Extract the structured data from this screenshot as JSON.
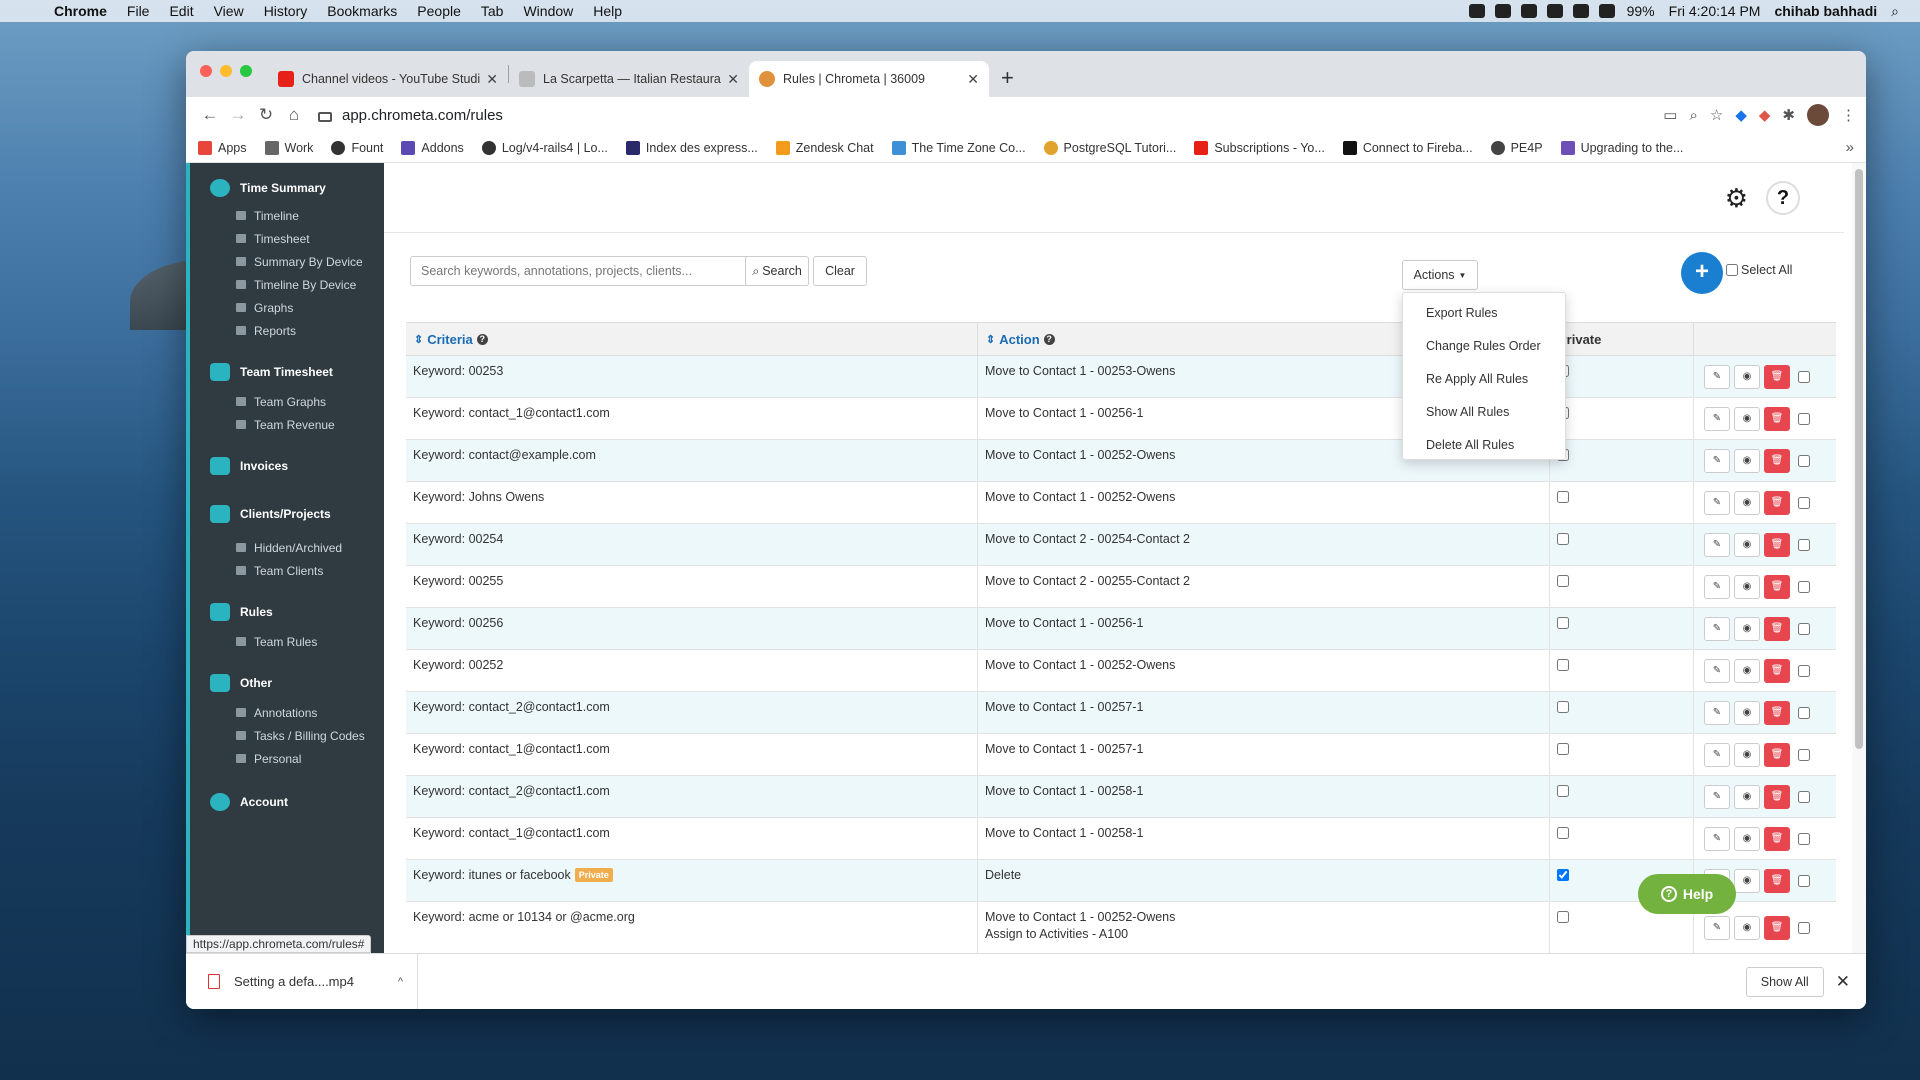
{
  "menubar": {
    "app": "Chrome",
    "items": [
      "File",
      "Edit",
      "View",
      "History",
      "Bookmarks",
      "People",
      "Tab",
      "Window",
      "Help"
    ],
    "battery": "99%",
    "clock": "Fri 4:20:14 PM",
    "user": "chihab bahhadi"
  },
  "browser": {
    "tabs": [
      {
        "title": "Channel videos - YouTube Studio",
        "favicon_color": "#e62117"
      },
      {
        "title": "La Scarpetta — Italian Restaurant",
        "favicon_color": "#999999"
      },
      {
        "title": "Rules | Chrometa | 36009",
        "favicon_color": "#e0913c"
      }
    ],
    "url": "app.chrometa.com/rules",
    "bookmarks": [
      {
        "label": "Apps",
        "color": "#e8453c"
      },
      {
        "label": "Work",
        "color": "#666666"
      },
      {
        "label": "Fount",
        "color": "#333333"
      },
      {
        "label": "Addons",
        "color": "#5b4ab3"
      },
      {
        "label": "Log/v4-rails4 | Lo...",
        "color": "#333333"
      },
      {
        "label": "Index des express...",
        "color": "#2a2a6a"
      },
      {
        "label": "Zendesk Chat",
        "color": "#f29b1d"
      },
      {
        "label": "The Time Zone Co...",
        "color": "#3d8fd6"
      },
      {
        "label": "PostgreSQL Tutori...",
        "color": "#e0a32e"
      },
      {
        "label": "Subscriptions - Yo...",
        "color": "#e62117"
      },
      {
        "label": "Connect to Fireba...",
        "color": "#111111"
      },
      {
        "label": "PE4P",
        "color": "#444444"
      },
      {
        "label": "Upgrading to the...",
        "color": "#6e4fb8"
      }
    ]
  },
  "sidebar": {
    "sections": [
      {
        "label": "Time Summary",
        "icon": "clock-icon",
        "items": [
          "Timeline",
          "Timesheet",
          "Summary By Device",
          "Timeline By Device",
          "Graphs",
          "Reports"
        ]
      },
      {
        "label": "Team Timesheet",
        "icon": "users-icon",
        "items": [
          "Team Graphs",
          "Team Revenue"
        ]
      },
      {
        "label": "Invoices",
        "icon": "money-icon",
        "items": []
      },
      {
        "label": "Clients/Projects",
        "icon": "briefcase-icon",
        "items": [
          "Hidden/Archived",
          "Team Clients"
        ]
      },
      {
        "label": "Rules",
        "icon": "gears-icon",
        "items": [
          "Team Rules"
        ]
      },
      {
        "label": "Other",
        "icon": "copy-icon",
        "items": [
          "Annotations",
          "Tasks / Billing Codes",
          "Personal"
        ]
      },
      {
        "label": "Account",
        "icon": "user-icon",
        "items": []
      }
    ]
  },
  "toolbar": {
    "search_placeholder": "Search keywords, annotations, projects, clients...",
    "search_label": "Search",
    "clear_label": "Clear",
    "actions_label": "Actions",
    "select_all_label": "Select All"
  },
  "actions_menu": [
    "Export Rules",
    "Change Rules Order",
    "Re Apply All Rules",
    "Show All Rules",
    "Delete All Rules"
  ],
  "table": {
    "headers": {
      "criteria": "Criteria",
      "action": "Action",
      "private": "Private"
    },
    "rows": [
      {
        "criteria": "Keyword: 00253",
        "action": "Move to Contact 1 - 00253-Owens",
        "action2": "",
        "private": false,
        "badge": ""
      },
      {
        "criteria": "Keyword: contact_1@contact1.com",
        "action": "Move to Contact 1 - 00256-1",
        "action2": "",
        "private": false,
        "badge": ""
      },
      {
        "criteria": "Keyword: contact@example.com",
        "action": "Move to Contact 1 - 00252-Owens",
        "action2": "",
        "private": false,
        "badge": ""
      },
      {
        "criteria": "Keyword: Johns Owens",
        "action": "Move to Contact 1 - 00252-Owens",
        "action2": "",
        "private": false,
        "badge": ""
      },
      {
        "criteria": "Keyword: 00254",
        "action": "Move to Contact 2 - 00254-Contact 2",
        "action2": "",
        "private": false,
        "badge": ""
      },
      {
        "criteria": "Keyword: 00255",
        "action": "Move to Contact 2 - 00255-Contact 2",
        "action2": "",
        "private": false,
        "badge": ""
      },
      {
        "criteria": "Keyword: 00256",
        "action": "Move to Contact 1 - 00256-1",
        "action2": "",
        "private": false,
        "badge": ""
      },
      {
        "criteria": "Keyword: 00252",
        "action": "Move to Contact 1 - 00252-Owens",
        "action2": "",
        "private": false,
        "badge": ""
      },
      {
        "criteria": "Keyword: contact_2@contact1.com",
        "action": "Move to Contact 1 - 00257-1",
        "action2": "",
        "private": false,
        "badge": ""
      },
      {
        "criteria": "Keyword: contact_1@contact1.com",
        "action": "Move to Contact 1 - 00257-1",
        "action2": "",
        "private": false,
        "badge": ""
      },
      {
        "criteria": "Keyword: contact_2@contact1.com",
        "action": "Move to Contact 1 - 00258-1",
        "action2": "",
        "private": false,
        "badge": ""
      },
      {
        "criteria": "Keyword: contact_1@contact1.com",
        "action": "Move to Contact 1 - 00258-1",
        "action2": "",
        "private": false,
        "badge": ""
      },
      {
        "criteria": "Keyword: itunes or facebook",
        "action": "Delete",
        "action2": "",
        "private": true,
        "badge": "Private"
      },
      {
        "criteria": "Keyword: acme or 10134 or @acme.org",
        "action": "Move to Contact 1 - 00252-Owens",
        "action2": "Assign to Activities - A100",
        "private": false,
        "badge": ""
      }
    ]
  },
  "help_button": "Help",
  "status_url": "https://app.chrometa.com/rules#",
  "download": {
    "filename": "Setting a defa....mp4",
    "show_all": "Show All"
  }
}
